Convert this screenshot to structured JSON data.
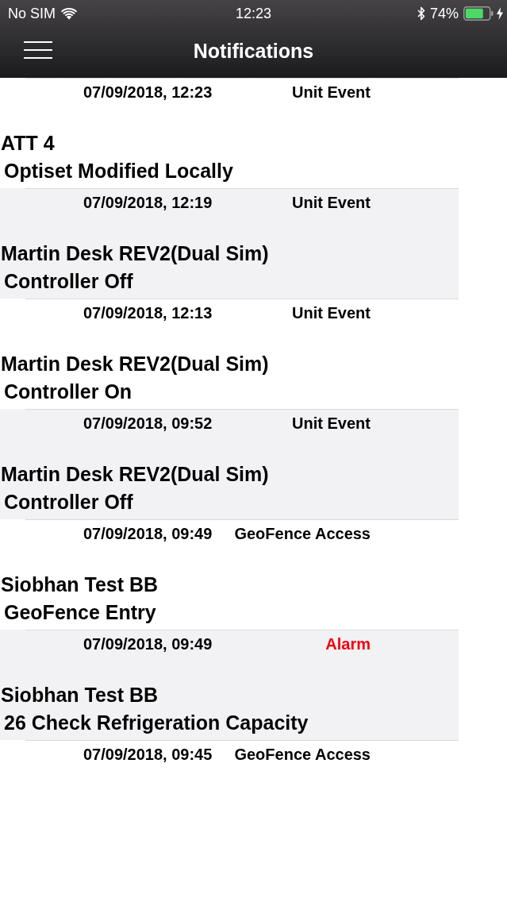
{
  "status_bar": {
    "carrier": "No SIM",
    "time": "12:23",
    "battery": "74%"
  },
  "nav_bar": {
    "title": "Notifications"
  },
  "notifications": [
    {
      "date": "07/09/2018, 12:23",
      "type": "Unit Event",
      "kind": "event",
      "unit": "ATT 4",
      "message": "Optiset Modified Locally"
    },
    {
      "date": "07/09/2018, 12:19",
      "type": "Unit Event",
      "kind": "event",
      "unit": "Martin Desk REV2(Dual Sim)",
      "message": "Controller Off"
    },
    {
      "date": "07/09/2018, 12:13",
      "type": "Unit Event",
      "kind": "event",
      "unit": "Martin Desk REV2(Dual Sim)",
      "message": "Controller On"
    },
    {
      "date": "07/09/2018, 09:52",
      "type": "Unit Event",
      "kind": "event",
      "unit": "Martin Desk REV2(Dual Sim)",
      "message": "Controller Off"
    },
    {
      "date": "07/09/2018, 09:49",
      "type": "GeoFence Access",
      "kind": "event",
      "unit": "Siobhan Test BB",
      "message": "GeoFence Entry"
    },
    {
      "date": "07/09/2018, 09:49",
      "type": "Alarm",
      "kind": "alarm",
      "unit": "Siobhan Test BB",
      "message": "26 Check Refrigeration Capacity"
    },
    {
      "date": "07/09/2018, 09:45",
      "type": "GeoFence Access",
      "kind": "event"
    }
  ]
}
